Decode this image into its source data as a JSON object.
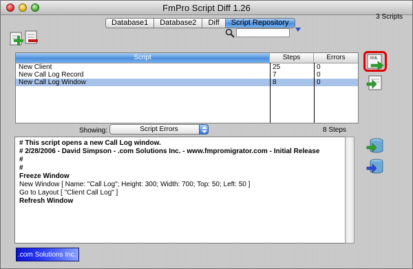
{
  "window": {
    "title": "FmPro Script Diff 1.26"
  },
  "tabs": [
    "Database1",
    "Database2",
    "Diff",
    "Script Repository"
  ],
  "scripts_count": "3  Scripts",
  "table": {
    "columns": [
      "Script",
      "Steps",
      "Errors"
    ],
    "rows": [
      {
        "script": "New Client",
        "steps": "25",
        "errors": "0"
      },
      {
        "script": "New Call Log Record",
        "steps": "7",
        "errors": "0"
      },
      {
        "script": "New Call Log Window",
        "steps": "8",
        "errors": "0"
      }
    ],
    "selected_index": 2
  },
  "showing": {
    "label": "Showing:",
    "value": "Script Errors"
  },
  "steps_count": "8     Steps",
  "script_lines": [
    "#   This script opens a new Call Log window.",
    "#   2/28/2006 - David Simpson - .com Solutions Inc. - www.fmpromigrator.com - Initial Release",
    "#",
    "#",
    "Freeze Window",
    "New Window [ Name: \"Call Log\"; Height: 300; Width: 700; Top: 50; Left: 50 ]",
    "Go to Layout [ \"Client Call Log\" ]",
    "Refresh Window"
  ],
  "side_icons": [
    "export-xml-icon",
    "import-file-icon",
    "database-add-icon",
    "database-refresh-icon"
  ],
  "logo_text": ".com Solutions Inc.",
  "colors": {
    "highlight": "#e00000",
    "accent": "#4b8fdc",
    "selection": "#a8c3ea"
  }
}
